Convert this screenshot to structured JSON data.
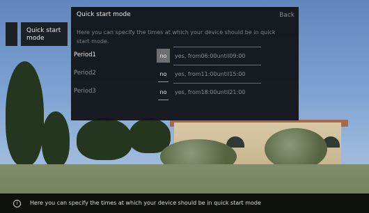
{
  "sidebar": {
    "item_label": "Quick start mode"
  },
  "dialog": {
    "title": "Quick start mode",
    "back_label": "Back",
    "description": "Here you can specify the times at which your device should be in quick start mode.",
    "periods": [
      {
        "label": "Period1",
        "toggle": "no",
        "from_label": "yes, from",
        "from": "06:00",
        "until_label": "until",
        "until": "09:00"
      },
      {
        "label": "Period2",
        "toggle": "no",
        "from_label": "yes, from",
        "from": "11:00",
        "until_label": "until",
        "until": "15:00"
      },
      {
        "label": "Period3",
        "toggle": "no",
        "from_label": "yes, from",
        "from": "18:00",
        "until_label": "until",
        "until": "21:00"
      }
    ]
  },
  "info_bar": {
    "icon": "info-icon",
    "text": "Here you can specify the times at which your device should be in quick start mode"
  }
}
